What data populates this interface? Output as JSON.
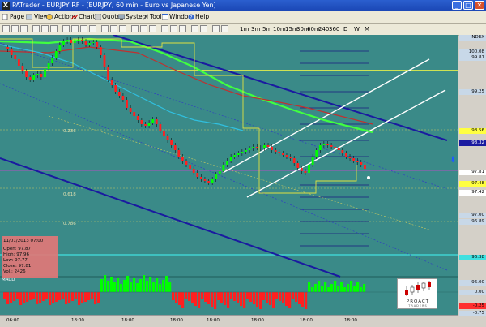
{
  "window": {
    "title": "PATrader - EURJPY RF - [EURJPY, 60 min - Euro vs Japanese Yen]",
    "app_icon": "X",
    "minimize": "_",
    "maximize": "□",
    "close": "✕"
  },
  "menu": [
    "Page",
    "View",
    "Actions",
    "Charts",
    "Quotes",
    "System",
    "Tools",
    "Window",
    "Help"
  ],
  "toolbar": {
    "timeframes": [
      "1m",
      "3m",
      "5m",
      "10m",
      "15m",
      "30m",
      "60m",
      "240",
      "360",
      "D",
      "W",
      "M"
    ]
  },
  "chart": {
    "symbol": "EURJPY",
    "timeframe": "60 min",
    "level_labels": [
      "0.236",
      "0.618",
      "0.786"
    ],
    "top_right_label": "INDEX",
    "series_colors": {
      "background": "#3a8a88",
      "bull_candle": "#00ff00",
      "bear_candle": "#ff2020",
      "ma_green": "#40ff40",
      "ma_red": "#c03030",
      "ma_cyan": "#30c0e0",
      "yellow_level": "#ffff40",
      "channel_blue": "#1a1aa0",
      "channel_white": "#ffffff"
    }
  },
  "price_scale": [
    {
      "text": "100.08",
      "bg": "#c8d8e8"
    },
    {
      "text": "99.81",
      "bg": "#c8d8e8"
    },
    {
      "text": "99.25",
      "bg": "#c8d8e8"
    },
    {
      "text": "98.56",
      "bg": "#ffff40"
    },
    {
      "text": "98.32",
      "bg": "#1a1aa0",
      "color": "#ffffff"
    },
    {
      "text": "97.81",
      "bg": "#ffffff"
    },
    {
      "text": "97.48",
      "bg": "#ffff40"
    },
    {
      "text": "97.42",
      "bg": "#ffffff"
    },
    {
      "text": "97.00",
      "bg": "#c8d8e8"
    },
    {
      "text": "96.89",
      "bg": "#c8d8e8"
    },
    {
      "text": "96.38",
      "bg": "#40e0e0"
    },
    {
      "text": "96.00",
      "bg": "#c8d8e8"
    },
    {
      "text": "0.00",
      "bg": "#c8d8e8"
    },
    {
      "text": "-0.25",
      "bg": "#ff3030"
    },
    {
      "text": "-0.75",
      "bg": "#c8d8e8"
    }
  ],
  "ohlc": {
    "date": "11/01/2013 07:00",
    "open": "Open: 97.87",
    "high": "High: 97.96",
    "low": "Low: 97.77",
    "close": "Close: 97.81",
    "vol": "Vol.: 2426"
  },
  "indicator": {
    "name": "MACD"
  },
  "brand": {
    "name": "PROACT",
    "sub": "TRADERS"
  },
  "time_labels": [
    "06:00",
    "18:00",
    "18:00",
    "18:00",
    "18:00",
    "18:00",
    "18:00",
    "18:00"
  ]
}
